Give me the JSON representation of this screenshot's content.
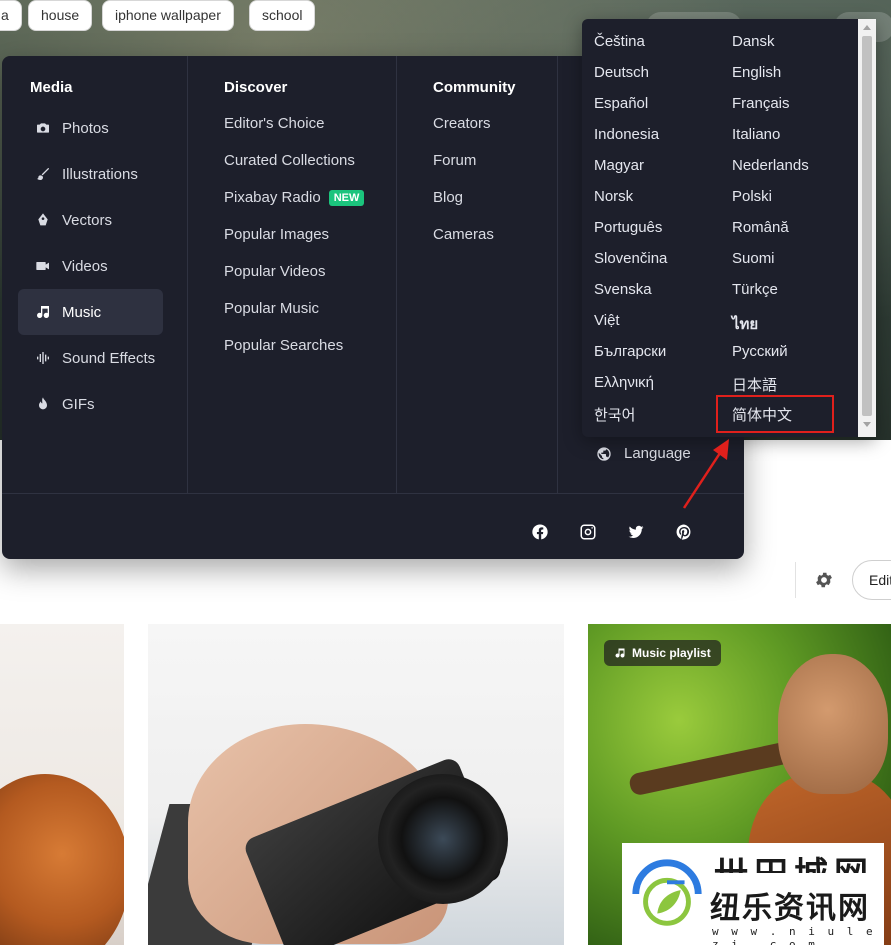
{
  "menu": {
    "media": {
      "title": "Media",
      "items": [
        {
          "label": "Photos",
          "icon": "camera-icon"
        },
        {
          "label": "Illustrations",
          "icon": "brush-icon"
        },
        {
          "label": "Vectors",
          "icon": "pen-tool-icon"
        },
        {
          "label": "Videos",
          "icon": "video-camera-icon"
        },
        {
          "label": "Music",
          "icon": "music-note-icon",
          "active": true
        },
        {
          "label": "Sound Effects",
          "icon": "waveform-icon"
        },
        {
          "label": "GIFs",
          "icon": "flame-icon"
        }
      ]
    },
    "discover": {
      "title": "Discover",
      "links": [
        "Editor's Choice",
        "Curated Collections",
        "Pixabay Radio",
        "Popular Images",
        "Popular Videos",
        "Popular Music",
        "Popular Searches"
      ],
      "new_badge": "NEW"
    },
    "community": {
      "title": "Community",
      "links": [
        "Creators",
        "Forum",
        "Blog",
        "Cameras"
      ]
    },
    "language_label": "Language",
    "social": [
      "facebook-icon",
      "instagram-icon",
      "twitter-icon",
      "pinterest-icon"
    ]
  },
  "languages": [
    "Čeština",
    "Dansk",
    "Deutsch",
    "English",
    "Español",
    "Français",
    "Indonesia",
    "Italiano",
    "Magyar",
    "Nederlands",
    "Norsk",
    "Polski",
    "Português",
    "Română",
    "Slovenčina",
    "Suomi",
    "Svenska",
    "Türkçe",
    "Việt",
    "ไทย",
    "Български",
    "Русский",
    "Ελληνική",
    "日本語",
    "한국어",
    "简体中文"
  ],
  "highlighted_language": "简体中文",
  "tags": [
    "a",
    "house",
    "iphone wallpaper",
    "school"
  ],
  "edit_label": "Edit",
  "photo_badge": "Music playlist",
  "watermark": {
    "brand_top": "卅田城网",
    "brand": "纽乐资讯网",
    "url": "w w w . n i u l e z i . c o m"
  },
  "colors": {
    "menu_bg": "#1d1f2b",
    "new_badge": "#1bc47d",
    "highlight": "#e0201c"
  }
}
